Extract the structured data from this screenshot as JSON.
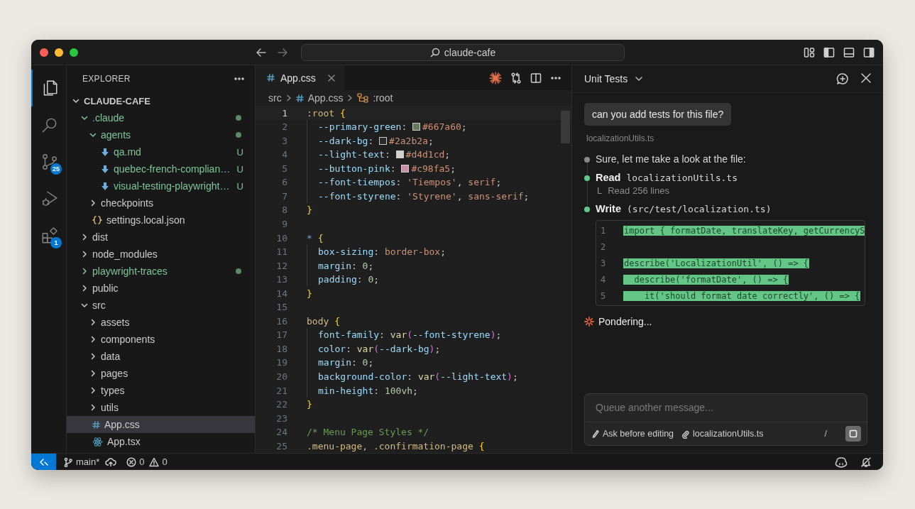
{
  "window": {
    "title": "claude-cafe"
  },
  "activity_bar": [
    {
      "kind": "files",
      "selected": true
    },
    {
      "kind": "search",
      "selected": false
    },
    {
      "kind": "source-control",
      "selected": false,
      "badge": "25"
    },
    {
      "kind": "run-debug",
      "selected": false
    },
    {
      "kind": "extensions",
      "selected": false,
      "badge": "1"
    }
  ],
  "explorer": {
    "title": "EXPLORER",
    "tree": [
      {
        "label": "CLAUDE-CAFE",
        "kind": "root",
        "expanded": true,
        "untracked": false,
        "selected": false,
        "children": [
          {
            "label": ".claude",
            "kind": "folder",
            "expanded": true,
            "untracked": true,
            "selected": false,
            "children": [
              {
                "label": "agents",
                "kind": "folder",
                "expanded": true,
                "untracked": true,
                "selected": false,
                "children": [
                  {
                    "label": "qa.md",
                    "kind": "markdown",
                    "untracked": true,
                    "selected": false,
                    "badge": "U"
                  },
                  {
                    "label": "quebec-french-complian…",
                    "kind": "markdown",
                    "untracked": true,
                    "selected": false,
                    "badge": "U"
                  },
                  {
                    "label": "visual-testing-playwright…",
                    "kind": "markdown",
                    "untracked": true,
                    "selected": false,
                    "badge": "U"
                  }
                ]
              },
              {
                "label": "checkpoints",
                "kind": "folder",
                "expanded": false,
                "untracked": false,
                "selected": false
              },
              {
                "label": "settings.local.json",
                "kind": "json",
                "untracked": false,
                "selected": false
              }
            ]
          },
          {
            "label": "dist",
            "kind": "folder",
            "expanded": false,
            "untracked": false,
            "selected": false
          },
          {
            "label": "node_modules",
            "kind": "folder",
            "expanded": false,
            "untracked": false,
            "selected": false
          },
          {
            "label": "playwright-traces",
            "kind": "folder",
            "expanded": false,
            "untracked": true,
            "selected": false
          },
          {
            "label": "public",
            "kind": "folder",
            "expanded": false,
            "untracked": false,
            "selected": false
          },
          {
            "label": "src",
            "kind": "folder",
            "expanded": true,
            "untracked": false,
            "selected": false,
            "children": [
              {
                "label": "assets",
                "kind": "folder",
                "expanded": false,
                "untracked": false,
                "selected": false
              },
              {
                "label": "components",
                "kind": "folder",
                "expanded": false,
                "untracked": false,
                "selected": false
              },
              {
                "label": "data",
                "kind": "folder",
                "expanded": false,
                "untracked": false,
                "selected": false
              },
              {
                "label": "pages",
                "kind": "folder",
                "expanded": false,
                "untracked": false,
                "selected": false
              },
              {
                "label": "types",
                "kind": "folder",
                "expanded": false,
                "untracked": false,
                "selected": false
              },
              {
                "label": "utils",
                "kind": "folder",
                "expanded": false,
                "untracked": false,
                "selected": false
              },
              {
                "label": "App.css",
                "kind": "css",
                "untracked": false,
                "selected": true
              },
              {
                "label": "App.tsx",
                "kind": "react",
                "untracked": false,
                "selected": false
              }
            ]
          }
        ]
      }
    ]
  },
  "editor": {
    "tabs": [
      {
        "label": "App.css",
        "kind": "css",
        "selected": true
      }
    ],
    "breadcrumbs": [
      {
        "label": "src",
        "kind": "folder"
      },
      {
        "label": "App.css",
        "kind": "css"
      },
      {
        "label": ":root",
        "kind": "symbol"
      }
    ],
    "lines": [
      {
        "number": "1",
        "current": true,
        "indented": false,
        "tokens": [
          {
            "kind": "selector",
            "text": ":root"
          },
          {
            "kind": "brace",
            "text": "{"
          }
        ]
      },
      {
        "number": "2",
        "current": false,
        "indented": true,
        "tokens": [
          {
            "kind": "property",
            "text": "--primary-green"
          },
          {
            "kind": "punct",
            "text": ":"
          },
          {
            "kind": "swatch",
            "color": "#667a60"
          },
          {
            "kind": "value",
            "text": "#667a60"
          },
          {
            "kind": "punct",
            "text": ";"
          }
        ]
      },
      {
        "number": "3",
        "current": false,
        "indented": true,
        "tokens": [
          {
            "kind": "property",
            "text": "--dark-bg"
          },
          {
            "kind": "punct",
            "text": ":"
          },
          {
            "kind": "swatch",
            "color": "#2a2b2a"
          },
          {
            "kind": "value",
            "text": "#2a2b2a"
          },
          {
            "kind": "punct",
            "text": ";"
          }
        ]
      },
      {
        "number": "4",
        "current": false,
        "indented": true,
        "tokens": [
          {
            "kind": "property",
            "text": "--light-text"
          },
          {
            "kind": "punct",
            "text": ":"
          },
          {
            "kind": "swatch",
            "color": "#d4d1cd"
          },
          {
            "kind": "value",
            "text": "#d4d1cd"
          },
          {
            "kind": "punct",
            "text": ";"
          }
        ]
      },
      {
        "number": "5",
        "current": false,
        "indented": true,
        "tokens": [
          {
            "kind": "property",
            "text": "--button-pink"
          },
          {
            "kind": "punct",
            "text": ":"
          },
          {
            "kind": "swatch",
            "color": "#c98fa5"
          },
          {
            "kind": "value",
            "text": "#c98fa5"
          },
          {
            "kind": "punct",
            "text": ";"
          }
        ]
      },
      {
        "number": "6",
        "current": false,
        "indented": true,
        "tokens": [
          {
            "kind": "property",
            "text": "--font-tiempos"
          },
          {
            "kind": "punct",
            "text": ":"
          },
          {
            "kind": "value",
            "text": "'Tiempos'"
          },
          {
            "kind": "punct",
            "text": ","
          },
          {
            "kind": "value",
            "text": "serif"
          },
          {
            "kind": "punct",
            "text": ";"
          }
        ]
      },
      {
        "number": "7",
        "current": false,
        "indented": true,
        "tokens": [
          {
            "kind": "property",
            "text": "--font-styrene"
          },
          {
            "kind": "punct",
            "text": ":"
          },
          {
            "kind": "value",
            "text": "'Styrene'"
          },
          {
            "kind": "punct",
            "text": ","
          },
          {
            "kind": "value",
            "text": "sans-serif"
          },
          {
            "kind": "punct",
            "text": ";"
          }
        ]
      },
      {
        "number": "8",
        "current": false,
        "indented": false,
        "tokens": [
          {
            "kind": "brace",
            "text": "}"
          }
        ]
      },
      {
        "number": "9",
        "current": false,
        "indented": false
      },
      {
        "number": "10",
        "current": false,
        "indented": false,
        "tokens": [
          {
            "kind": "universal",
            "text": "*"
          },
          {
            "kind": "brace",
            "text": "{"
          }
        ]
      },
      {
        "number": "11",
        "current": false,
        "indented": true,
        "tokens": [
          {
            "kind": "property",
            "text": "box-sizing"
          },
          {
            "kind": "punct",
            "text": ":"
          },
          {
            "kind": "value",
            "text": "border-box"
          },
          {
            "kind": "punct",
            "text": ";"
          }
        ]
      },
      {
        "number": "12",
        "current": false,
        "indented": true,
        "tokens": [
          {
            "kind": "property",
            "text": "margin"
          },
          {
            "kind": "punct",
            "text": ":"
          },
          {
            "kind": "number",
            "text": "0"
          },
          {
            "kind": "punct",
            "text": ";"
          }
        ]
      },
      {
        "number": "13",
        "current": false,
        "indented": true,
        "tokens": [
          {
            "kind": "property",
            "text": "padding"
          },
          {
            "kind": "punct",
            "text": ":"
          },
          {
            "kind": "number",
            "text": "0"
          },
          {
            "kind": "punct",
            "text": ";"
          }
        ]
      },
      {
        "number": "14",
        "current": false,
        "indented": false,
        "tokens": [
          {
            "kind": "brace",
            "text": "}"
          }
        ]
      },
      {
        "number": "15",
        "current": false,
        "indented": false
      },
      {
        "number": "16",
        "current": false,
        "indented": false,
        "tokens": [
          {
            "kind": "selector",
            "text": "body"
          },
          {
            "kind": "brace",
            "text": "{"
          }
        ]
      },
      {
        "number": "17",
        "current": false,
        "indented": true,
        "tokens": [
          {
            "kind": "property",
            "text": "font-family"
          },
          {
            "kind": "punct",
            "text": ":"
          },
          {
            "kind": "function",
            "text": "var"
          },
          {
            "kind": "paren",
            "text": "("
          },
          {
            "kind": "property",
            "text": "--font-styrene"
          },
          {
            "kind": "paren",
            "text": ")"
          },
          {
            "kind": "punct",
            "text": ";"
          }
        ]
      },
      {
        "number": "18",
        "current": false,
        "indented": true,
        "tokens": [
          {
            "kind": "property",
            "text": "color"
          },
          {
            "kind": "punct",
            "text": ":"
          },
          {
            "kind": "function",
            "text": "var"
          },
          {
            "kind": "paren",
            "text": "("
          },
          {
            "kind": "property",
            "text": "--dark-bg"
          },
          {
            "kind": "paren",
            "text": ")"
          },
          {
            "kind": "punct",
            "text": ";"
          }
        ]
      },
      {
        "number": "19",
        "current": false,
        "indented": true,
        "tokens": [
          {
            "kind": "property",
            "text": "margin"
          },
          {
            "kind": "punct",
            "text": ":"
          },
          {
            "kind": "number",
            "text": "0"
          },
          {
            "kind": "punct",
            "text": ";"
          }
        ]
      },
      {
        "number": "20",
        "current": false,
        "indented": true,
        "tokens": [
          {
            "kind": "property",
            "text": "background-color"
          },
          {
            "kind": "punct",
            "text": ":"
          },
          {
            "kind": "function",
            "text": "var"
          },
          {
            "kind": "paren",
            "text": "("
          },
          {
            "kind": "property",
            "text": "--light-text"
          },
          {
            "kind": "paren",
            "text": ")"
          },
          {
            "kind": "punct",
            "text": ";"
          }
        ]
      },
      {
        "number": "21",
        "current": false,
        "indented": true,
        "tokens": [
          {
            "kind": "property",
            "text": "min-height"
          },
          {
            "kind": "punct",
            "text": ":"
          },
          {
            "kind": "number",
            "text": "100vh"
          },
          {
            "kind": "punct",
            "text": ";"
          }
        ]
      },
      {
        "number": "22",
        "current": false,
        "indented": false,
        "tokens": [
          {
            "kind": "brace",
            "text": "}"
          }
        ]
      },
      {
        "number": "23",
        "current": false,
        "indented": false
      },
      {
        "number": "24",
        "current": false,
        "indented": false,
        "tokens": [
          {
            "kind": "comment",
            "text": "/* Menu Page Styles */"
          }
        ]
      },
      {
        "number": "25",
        "current": false,
        "indented": false,
        "tokens": [
          {
            "kind": "selector",
            "text": ".menu-page, .confirmation-page"
          },
          {
            "kind": "brace",
            "text": "{"
          }
        ]
      }
    ]
  },
  "chat": {
    "title": "Unit Tests",
    "user_message": "can you add tests for this file?",
    "attachment": "localizationUtils.ts",
    "timeline": [
      {
        "kind": "message",
        "color": "#8a8a8a",
        "text": "Sure, let me take a look at the file:"
      },
      {
        "kind": "tool",
        "color": "#5fc88a",
        "tool": "Read",
        "target": "localizationUtils.ts",
        "result_marker": "L",
        "result": "Read 256 lines"
      },
      {
        "kind": "tool",
        "color": "#5fc88a",
        "tool": "Write",
        "target": "(src/test/localization.ts)",
        "diff": [
          {
            "number": "1",
            "text": "import { formatDate, translateKey, getCurrencyS"
          },
          {
            "number": "2"
          },
          {
            "number": "3",
            "text": "describe('LocalizationUtil', () => {"
          },
          {
            "number": "4",
            "text": "  describe('formatDate', () => {"
          },
          {
            "number": "5",
            "text": "    it('should format date correctly', () => {"
          }
        ]
      }
    ],
    "status": "Pondering...",
    "input": {
      "placeholder": "Queue another message..."
    },
    "mode": "Ask before editing",
    "context_file": "localizationUtils.ts",
    "command_hint": "/"
  },
  "status_bar": {
    "branch": "main*",
    "errors": "0",
    "warnings": "0"
  }
}
